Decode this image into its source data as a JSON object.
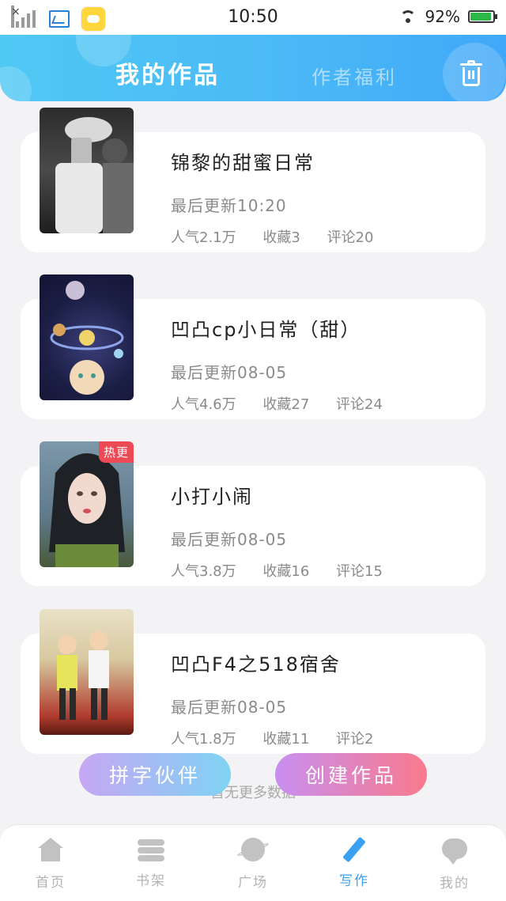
{
  "status_bar": {
    "time": "10:50",
    "battery": "92%",
    "battery_level": 0.92
  },
  "header": {
    "title": "我的作品",
    "tab2": "作者福利",
    "trash_icon": "trash-icon",
    "colors": {
      "start": "#50c8f4",
      "end": "#40a8f8"
    }
  },
  "works": [
    {
      "title": "锦黎的甜蜜日常",
      "updated": "最后更新10:20",
      "popularity": "人气2.1万",
      "favorites": "收藏3",
      "comments": "评论20",
      "tag": ""
    },
    {
      "title": "凹凸cp小日常（甜）",
      "updated": "最后更新08-05",
      "popularity": "人气4.6万",
      "favorites": "收藏27",
      "comments": "评论24",
      "tag": ""
    },
    {
      "title": "小打小闹",
      "updated": "最后更新08-05",
      "popularity": "人气3.8万",
      "favorites": "收藏16",
      "comments": "评论15",
      "tag": "热更"
    },
    {
      "title": "凹凸F4之518宿舍",
      "updated": "最后更新08-05",
      "popularity": "人气1.8万",
      "favorites": "收藏11",
      "comments": "评论2",
      "tag": ""
    }
  ],
  "list_footer": "暂无更多数据",
  "actions": {
    "left": "拼字伙伴",
    "right": "创建作品"
  },
  "nav": [
    {
      "label": "首页",
      "icon": "home-icon"
    },
    {
      "label": "书架",
      "icon": "bookshelf-icon"
    },
    {
      "label": "广场",
      "icon": "planet-icon"
    },
    {
      "label": "写作",
      "icon": "pen-icon",
      "active": true
    },
    {
      "label": "我的",
      "icon": "chat-icon"
    }
  ],
  "accent_color": "#3aa0f0",
  "hot_tag_color": "#ee4a55"
}
